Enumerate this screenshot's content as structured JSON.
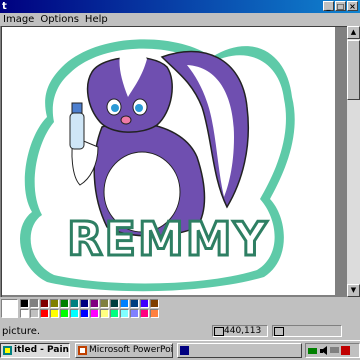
{
  "window": {
    "title": "t",
    "buttons": [
      "_",
      "□",
      "×"
    ]
  },
  "menu": [
    "Image",
    "Options",
    "Help"
  ],
  "canvas": {
    "image_title": "REMMY"
  },
  "palette": {
    "colors": [
      "#000000",
      "#808080",
      "#800000",
      "#808000",
      "#008000",
      "#008080",
      "#000080",
      "#800080",
      "#808040",
      "#004040",
      "#0080ff",
      "#004080",
      "#4000ff",
      "#804000",
      "#ffffff",
      "#c0c0c0",
      "#ff0000",
      "#ffff00",
      "#00ff00",
      "#00ffff",
      "#0000ff",
      "#ff00ff",
      "#ffff80",
      "#00ff80",
      "#80ffff",
      "#8080ff",
      "#ff0080",
      "#ff8040"
    ]
  },
  "status": {
    "help_text": "picture.",
    "coords": "440,113",
    "size": ""
  },
  "taskbar": {
    "tasks": [
      {
        "label": "itled - Paint",
        "active": true
      },
      {
        "label": "Microsoft PowerPoint - [mo",
        "active": false
      },
      {
        "label": "",
        "active": false
      }
    ]
  }
}
